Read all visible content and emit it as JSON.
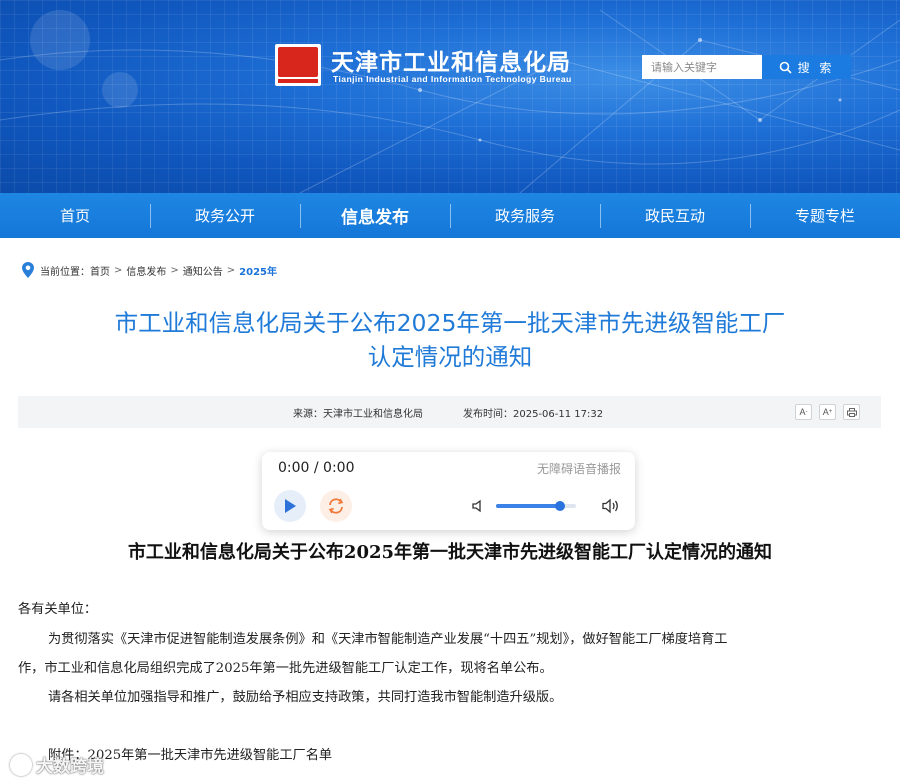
{
  "header": {
    "title": "天津市工业和信息化局",
    "subtitle": "Tianjin Industrial and Information Technology Bureau",
    "search_placeholder": "请输入关键字",
    "search_button": "搜 索"
  },
  "nav": {
    "items": [
      {
        "label": "首页"
      },
      {
        "label": "政务公开"
      },
      {
        "label": "信息发布",
        "active": true
      },
      {
        "label": "政务服务"
      },
      {
        "label": "政民互动"
      },
      {
        "label": "专题专栏"
      }
    ]
  },
  "breadcrumb": {
    "prefix": "当前位置：",
    "items": [
      "首页",
      "信息发布",
      "通知公告",
      "2025年"
    ],
    "separator": ">"
  },
  "article": {
    "title_line1": "市工业和信息化局关于公布2025年第一批天津市先进级智能工厂",
    "title_line2": "认定情况的通知",
    "source": "来源：天津市工业和信息化局",
    "date": "发布时间：2025-06-11 17:32",
    "tools": {
      "font_decrease": "A",
      "font_increase": "A",
      "print": "print"
    }
  },
  "player": {
    "time": "0:00 / 0:00",
    "label": "无障碍语音播报",
    "volume": 0.8
  },
  "body": {
    "heading": "市工业和信息化局关于公布2025年第一批天津市先进级智能工厂认定情况的通知",
    "salutation": "各有关单位：",
    "para1_line1": "为贯彻落实《天津市促进智能制造发展条例》和《天津市智能制造产业发展“十四五”规划》，做好智能工厂梯度培育工",
    "para1_line2": "作，市工业和信息化局组织完成了2025年第一批先进级智能工厂认定工作，现将名单公布。",
    "para2": "请各相关单位加强指导和推广，鼓励给予相应支持政策，共同打造我市智能制造升级版。",
    "attachment": "附件：2025年第一批天津市先进级智能工厂名单"
  },
  "watermark": "大数跨境",
  "colors": {
    "brand_blue": "#1f7ad8",
    "nav_blue": "#1577d8",
    "banner_blue": "#0f56bd",
    "seal_red": "#d9261c"
  }
}
